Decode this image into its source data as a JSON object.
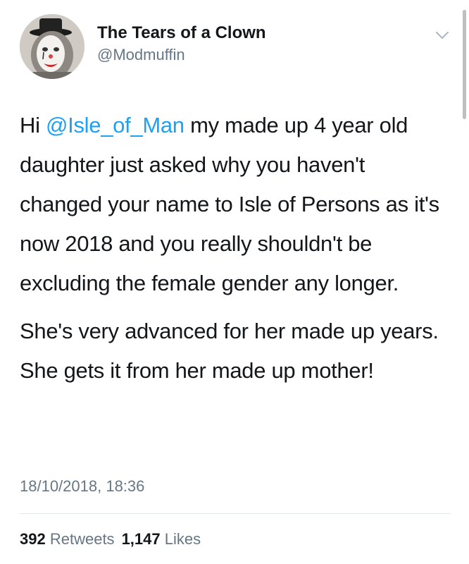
{
  "tweet": {
    "author": {
      "display_name": "The Tears of a Clown",
      "handle": "@Modmuffin",
      "avatar_icon": "clown-face-avatar"
    },
    "menu_icon": "chevron-down-icon",
    "text": {
      "p1_prefix": "Hi ",
      "mention": "@Isle_of_Man",
      "p1_rest": " my made up 4 year old daughter just asked why you haven't changed your name to Isle of Persons as it's now 2018 and you really shouldn't be excluding the female gender any longer.",
      "p2": "She's very advanced for her made up years. She gets it from her made up mother!"
    },
    "timestamp": "18/10/2018, 18:36",
    "stats": {
      "retweets_count": "392",
      "retweets_label": "Retweets",
      "likes_count": "1,147",
      "likes_label": "Likes"
    },
    "colors": {
      "mention": "#1da1f2",
      "secondary_text": "#657786",
      "primary_text": "#14171a",
      "divider": "#e1e8ed"
    }
  }
}
